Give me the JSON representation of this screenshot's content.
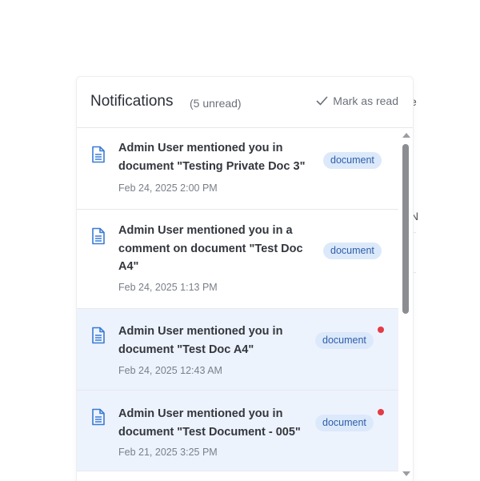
{
  "colors": {
    "accent": "#2f5ea8",
    "tag_bg": "#dce9fb",
    "unread_bg": "#edf3fd",
    "unread_dot": "#e53b45",
    "icon_blue": "#3a7bd5"
  },
  "header": {
    "title": "Notifications",
    "unread_count": "(5 unread)",
    "mark_read_label": "Mark as read",
    "mark_read_icon": "check-icon"
  },
  "notifications": [
    {
      "icon": "document-icon",
      "line1": "Admin User mentioned you in",
      "line2": "document \"Testing Private Doc 3\"",
      "line3": "",
      "time": "Feb 24, 2025 2:00 PM",
      "tag": "document",
      "unread": false
    },
    {
      "icon": "document-icon",
      "line1": "Admin User mentioned you in a",
      "line2": "comment on document \"Test Doc",
      "line3": "A4\"",
      "time": "Feb 24, 2025 1:13 PM",
      "tag": "document",
      "unread": false
    },
    {
      "icon": "document-icon",
      "line1": "Admin User mentioned you in",
      "line2": "document \"Test Doc A4\"",
      "line3": "",
      "time": "Feb 24, 2025 12:43 AM",
      "tag": "document",
      "unread": true
    },
    {
      "icon": "document-icon",
      "line1": "Admin User mentioned you in",
      "line2": "document \"Test Document - 005\"",
      "line3": "",
      "time": "Feb 21, 2025 3:25 PM",
      "tag": "document",
      "unread": true
    }
  ]
}
